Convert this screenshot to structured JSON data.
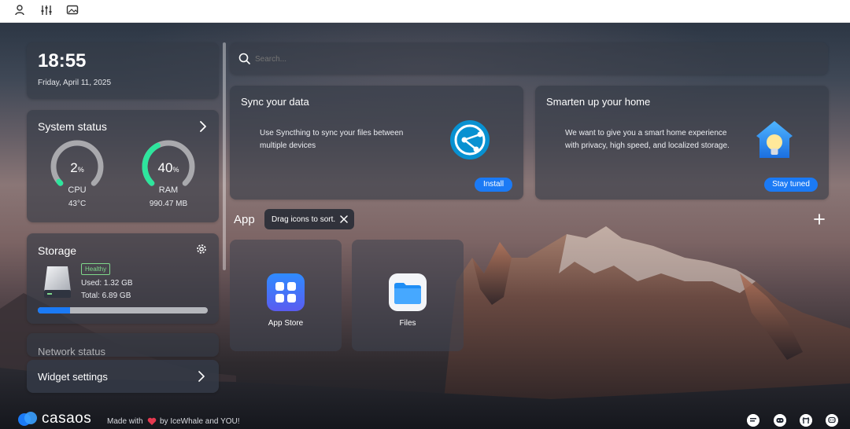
{
  "topbar": {
    "icons": [
      "user-settings-icon",
      "sliders-icon",
      "image-icon"
    ]
  },
  "clock": {
    "time": "18:55",
    "date": "Friday, April 11, 2025"
  },
  "system_status": {
    "title": "System status",
    "cpu": {
      "percent": "2",
      "unit": "%",
      "label": "CPU",
      "value": 2,
      "detail": "43°C"
    },
    "ram": {
      "percent": "40",
      "unit": "%",
      "label": "RAM",
      "value": 40,
      "detail": "990.47 MB"
    }
  },
  "storage": {
    "title": "Storage",
    "badge": "Healthy",
    "used": "Used: 1.32 GB",
    "total": "Total: 6.89 GB",
    "usage_fraction": 0.19
  },
  "network": {
    "title": "Network status"
  },
  "widget_settings": {
    "label": "Widget settings"
  },
  "search": {
    "placeholder": "Search..."
  },
  "sync_card": {
    "title": "Sync your data",
    "desc_line1": "Use Syncthing to sync your files between",
    "desc_line2": "multiple devices",
    "button": "Install"
  },
  "home_card": {
    "title": "Smarten up your home",
    "desc_line1": "We want to give you a smart home experience",
    "desc_line2": "with privacy, high speed, and localized storage.",
    "button": "Stay tuned"
  },
  "apps_section": {
    "title": "App",
    "tooltip": "Drag icons to sort."
  },
  "apps": [
    {
      "name": "App Store"
    },
    {
      "name": "Files"
    }
  ],
  "footer": {
    "brand": "casaos",
    "made_with": "Made with",
    "by": "by IceWhale and YOU!",
    "icons": [
      "forum-icon",
      "discord-icon",
      "github-icon",
      "chat-icon"
    ]
  },
  "colors": {
    "accent": "#1b7af5",
    "gauge_green": "#2ee59d",
    "healthy": "#7fd88b"
  }
}
